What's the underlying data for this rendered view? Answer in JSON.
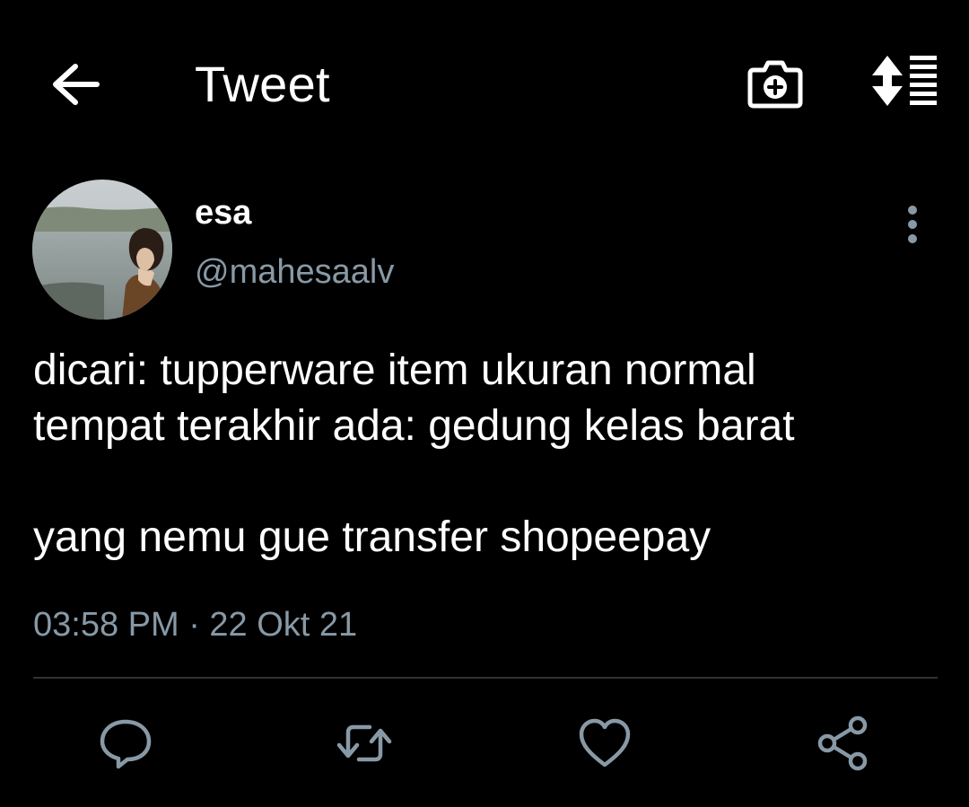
{
  "header": {
    "title": "Tweet",
    "back_icon": "arrow-left-icon",
    "camera_icon": "camera-plus-icon",
    "sort_icon": "sort-list-icon"
  },
  "tweet": {
    "display_name": "esa",
    "handle": "@mahesaalv",
    "text": "dicari: tupperware item ukuran normal\ntempat terakhir ada: gedung kelas barat\n\nyang nemu gue transfer shopeepay",
    "timestamp": "03:58 PM · 22 Okt 21"
  },
  "actions": {
    "reply_icon": "reply-bubble-icon",
    "retweet_icon": "retweet-icon",
    "like_icon": "heart-icon",
    "share_icon": "share-icon"
  },
  "colors": {
    "background": "#000000",
    "text_primary": "#ffffff",
    "text_secondary": "#8899a6",
    "divider": "#2f3336"
  }
}
